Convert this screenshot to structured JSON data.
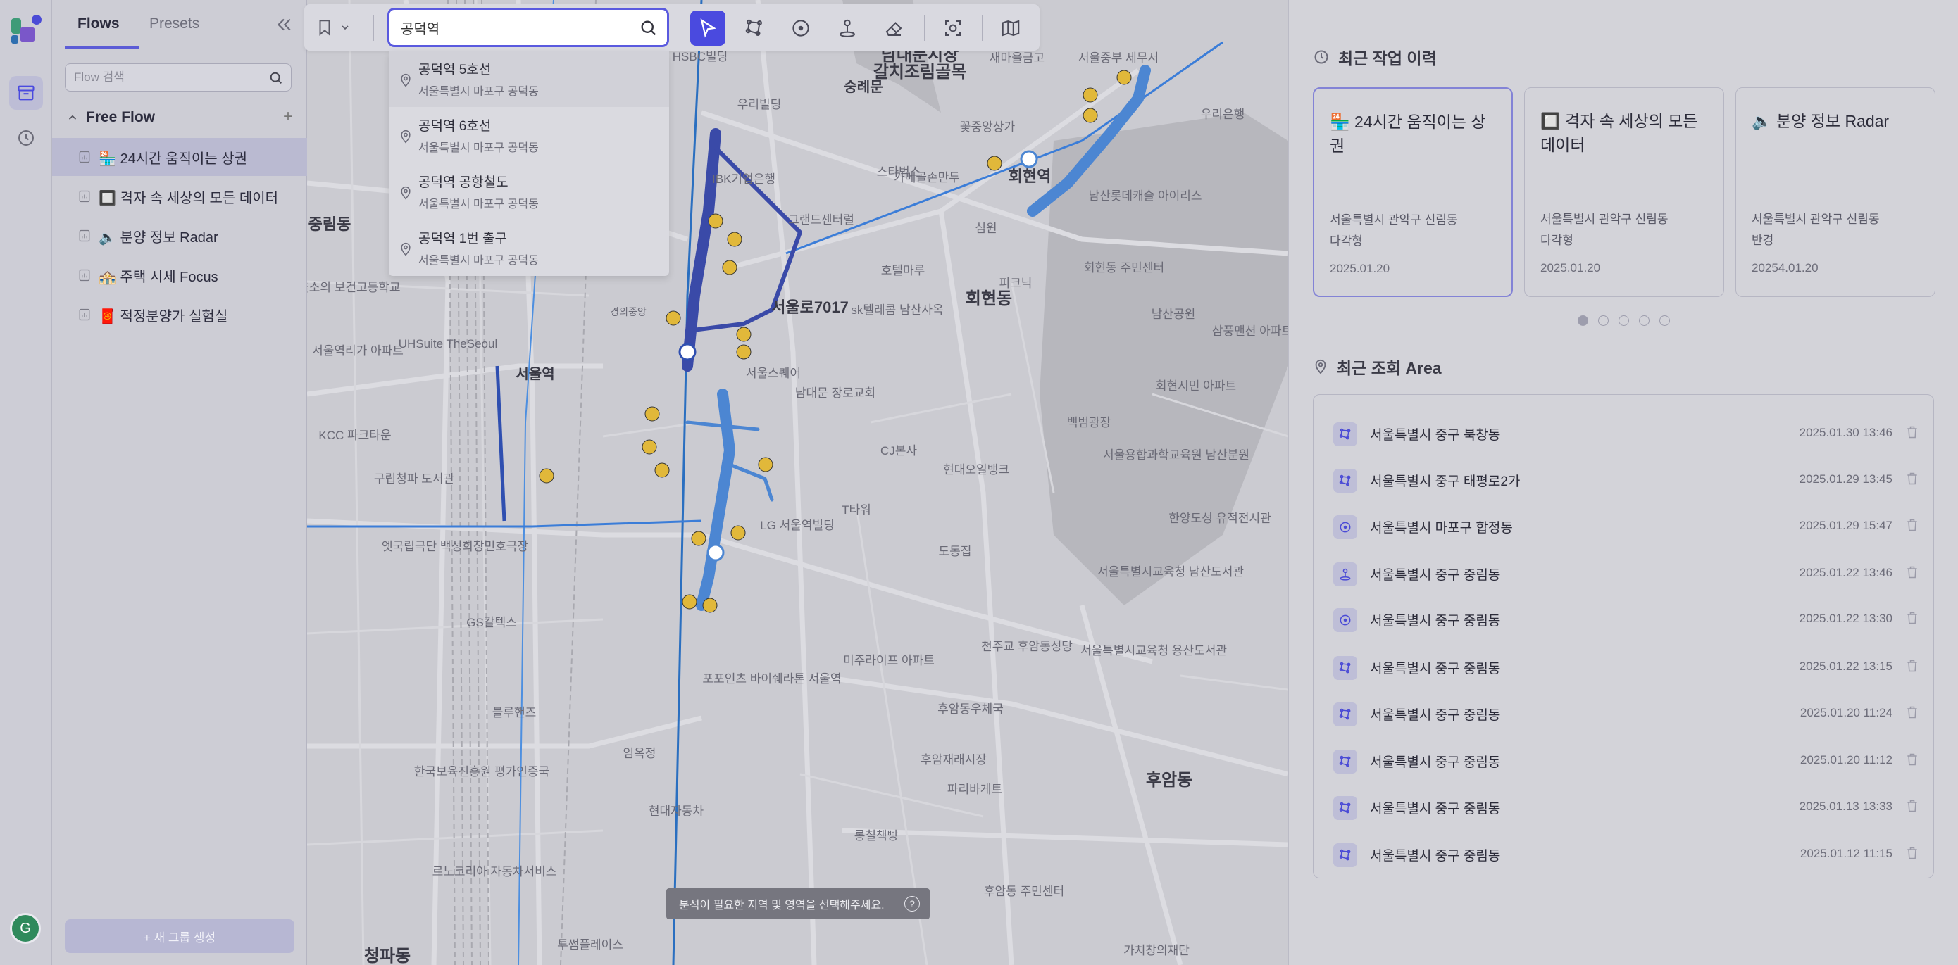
{
  "sidebar": {
    "tabs": [
      {
        "label": "Flows"
      },
      {
        "label": "Presets"
      }
    ],
    "search": {
      "placeholder": "Flow 검색"
    },
    "group": {
      "title": "Free Flow"
    },
    "items": [
      {
        "label": "🏪 24시간 움직이는 상권"
      },
      {
        "label": "🔲 격자 속 세상의 모든 데이터"
      },
      {
        "label": "🔈 분양 정보 Radar"
      },
      {
        "label": "🏤 주택 시세 Focus"
      },
      {
        "label": "🧧 적정분양가 실험실"
      }
    ],
    "new_group": "+ 새 그룹 생성",
    "avatar": "G"
  },
  "toolbar": {
    "search_value": "공덕역"
  },
  "dropdown": {
    "items": [
      {
        "title": "공덕역 5호선",
        "sub": "서울특별시 마포구 공덕동"
      },
      {
        "title": "공덕역 6호선",
        "sub": "서울특별시 마포구 공덕동"
      },
      {
        "title": "공덕역 공항철도",
        "sub": "서울특별시 마포구 공덕동"
      },
      {
        "title": "공덕역 1번 출구",
        "sub": "서울특별시 마포구 공덕동"
      }
    ]
  },
  "tooltip": {
    "text": "분석이 필요한 지역 및 영역을 선택해주세요.",
    "q": "?"
  },
  "recent": {
    "title": "최근 작업 이력",
    "cards": [
      {
        "title": "🏪 24시간 움직이는 상권",
        "addr": "서울특별시 관악구 신림동",
        "type": "다각형",
        "date": "2025.01.20"
      },
      {
        "title": "🔲 격자 속 세상의 모든 데이터",
        "addr": "서울특별시 관악구 신림동",
        "type": "다각형",
        "date": "2025.01.20"
      },
      {
        "title": "🔈 분양 정보 Radar",
        "addr": "서울특별시 관악구 신림동",
        "type": "반경",
        "date": "20254.01.20"
      }
    ]
  },
  "area": {
    "title": "최근 조회 Area",
    "rows": [
      {
        "name": "서울특별시 중구 북창동",
        "date": "2025.01.30 13:46",
        "icon": "polygon-icon"
      },
      {
        "name": "서울특별시 중구 태평로2가",
        "date": "2025.01.29 13:45",
        "icon": "polygon-icon"
      },
      {
        "name": "서울특별시 마포구 합정동",
        "date": "2025.01.29 15:47",
        "icon": "radius-icon"
      },
      {
        "name": "서울특별시 중구 중림동",
        "date": "2025.01.22 13:46",
        "icon": "isochrone-icon"
      },
      {
        "name": "서울특별시 중구 중림동",
        "date": "2025.01.22 13:30",
        "icon": "radius-icon"
      },
      {
        "name": "서울특별시 중구 중림동",
        "date": "2025.01.22 13:15",
        "icon": "polygon-icon"
      },
      {
        "name": "서울특별시 중구 중림동",
        "date": "2025.01.20 11:24",
        "icon": "polygon-icon"
      },
      {
        "name": "서울특별시 중구 중림동",
        "date": "2025.01.20 11:12",
        "icon": "polygon-icon"
      },
      {
        "name": "서울특별시 중구 중림동",
        "date": "2025.01.13 13:33",
        "icon": "polygon-icon"
      },
      {
        "name": "서울특별시 중구 중림동",
        "date": "2025.01.12 11:15",
        "icon": "polygon-icon"
      }
    ]
  },
  "map": {
    "labels": [
      {
        "t": "남대문시장"
      },
      {
        "t": "갈치조림골목"
      },
      {
        "t": "숭례문"
      },
      {
        "t": "회현역"
      },
      {
        "t": "회현동"
      },
      {
        "t": "서울역"
      },
      {
        "t": "서울로7017"
      },
      {
        "t": "중림동"
      },
      {
        "t": "후암동"
      },
      {
        "t": "청파동"
      },
      {
        "t": "남산공원"
      },
      {
        "t": "백범광장"
      },
      {
        "t": "스타벅스"
      },
      {
        "t": "우리은행"
      },
      {
        "t": "IBK기업은행"
      },
      {
        "t": "그랜드센터럴"
      },
      {
        "t": "호텔마루"
      },
      {
        "t": "sk텔레콤 남산사옥"
      },
      {
        "t": "서울스퀘어"
      },
      {
        "t": "남대문 장로교회"
      },
      {
        "t": "CJ본사"
      },
      {
        "t": "현대오일뱅크"
      },
      {
        "t": "LG 서울역빌딩"
      },
      {
        "t": "T타워"
      },
      {
        "t": "도동집"
      },
      {
        "t": "미주라이프 아파트"
      },
      {
        "t": "천주교 후암동성당"
      },
      {
        "t": "후암동우체국"
      },
      {
        "t": "후암재래시장"
      },
      {
        "t": "파리바게트"
      },
      {
        "t": "롱칠책빵"
      },
      {
        "t": "현대자동차"
      },
      {
        "t": "르노코리아 자동차서비스"
      },
      {
        "t": "한국보육진흥원 평가인증국"
      },
      {
        "t": "블루핸즈"
      },
      {
        "t": "GS칼텍스"
      },
      {
        "t": "엣국립극단 백성희장민호극장"
      },
      {
        "t": "구립청파 도서관"
      },
      {
        "t": "KCC 파크타운"
      },
      {
        "t": "서울역리가 아파트"
      },
      {
        "t": "UHSuite TheSeoul"
      },
      {
        "t": "서울소의 보건고등학교"
      },
      {
        "t": "회현시민 아파트"
      },
      {
        "t": "서울용합과학교육원 남산분원"
      },
      {
        "t": "서울특별시교육청 남산도서관"
      },
      {
        "t": "서울특별시교육청 용산도서관"
      },
      {
        "t": "한양도성 유적전시관"
      },
      {
        "t": "후암동 주민센터"
      },
      {
        "t": "회현동 주민센터"
      },
      {
        "t": "피크닉"
      },
      {
        "t": "꽃중앙상가"
      },
      {
        "t": "가메골손만두"
      },
      {
        "t": "심원"
      },
      {
        "t": "포포인츠 바이쉐라톤 서울역"
      },
      {
        "t": "임옥정"
      },
      {
        "t": "투썸플레이스"
      },
      {
        "t": "가치창의재단"
      },
      {
        "t": "새마을금고"
      },
      {
        "t": "서울중부 세무서"
      },
      {
        "t": "남산롯데캐슬 아이리스"
      },
      {
        "t": "삼풍맨션 아파트"
      },
      {
        "t": "HSBC빌딩"
      },
      {
        "t": "우리빌딩"
      },
      {
        "t": "경의중앙"
      }
    ]
  }
}
